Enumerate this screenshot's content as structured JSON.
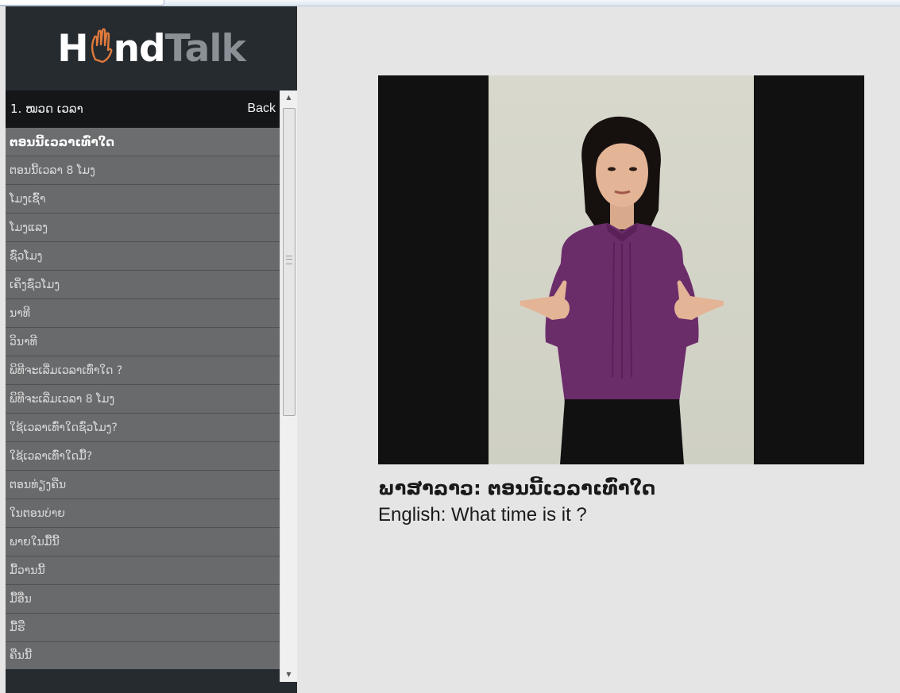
{
  "app": {
    "logo_part1": "H",
    "logo_part2": "nd",
    "logo_part3": "Talk"
  },
  "list": {
    "header_title": "1. ໝວດ ເວລາ",
    "back_label": "Back",
    "items": [
      {
        "label": "ຕອນນີ້ເວລາເທົ່າໃດ",
        "active": true
      },
      {
        "label": "ຕອນນີ້ເວລາ 8 ໂມງ"
      },
      {
        "label": "ໂມງເຊົ້າ"
      },
      {
        "label": "ໂມງແລງ"
      },
      {
        "label": "ຊົ່ວໂມງ"
      },
      {
        "label": "ເຄິ່ງຊົ່ວໂມງ"
      },
      {
        "label": "ນາທີ"
      },
      {
        "label": "ວິນາທີ"
      },
      {
        "label": "ພິທີຈະເລີ່ມເວລາເທົ່າໃດ ?"
      },
      {
        "label": "ພິທີຈະເລີ່ມເວລາ 8 ໂມງ"
      },
      {
        "label": "ໃຊ້ເວລາເທົ່າໃດຊົ່ວໂມງ?"
      },
      {
        "label": "ໃຊ້ເວລາເທົ່າໃດມື້?"
      },
      {
        "label": "ຕອນທ່ຽງຄືນ"
      },
      {
        "label": "ໃນຕອນບ່າຍ"
      },
      {
        "label": "ພາຍໃນມື້ນີ້"
      },
      {
        "label": "ມື້ວານນີ້"
      },
      {
        "label": "ມື້ອື່ນ"
      },
      {
        "label": "ມື້ຮື"
      },
      {
        "label": "ຄືນນີ້"
      }
    ]
  },
  "caption": {
    "lao": "ພາສາລາວ: ຕອນນີ້ເວລາເທົ່າໃດ",
    "english": "English: What time is it ?"
  },
  "colors": {
    "sidebar_bg": "#262b30",
    "list_item_bg": "#696a6c",
    "content_bg": "#e5e5e5",
    "logo_accent": "#e07a3c"
  },
  "icons": {
    "logo_hand": "hand-sign-icon",
    "scroll_up": "triangle-up-icon",
    "scroll_down": "triangle-down-icon"
  }
}
